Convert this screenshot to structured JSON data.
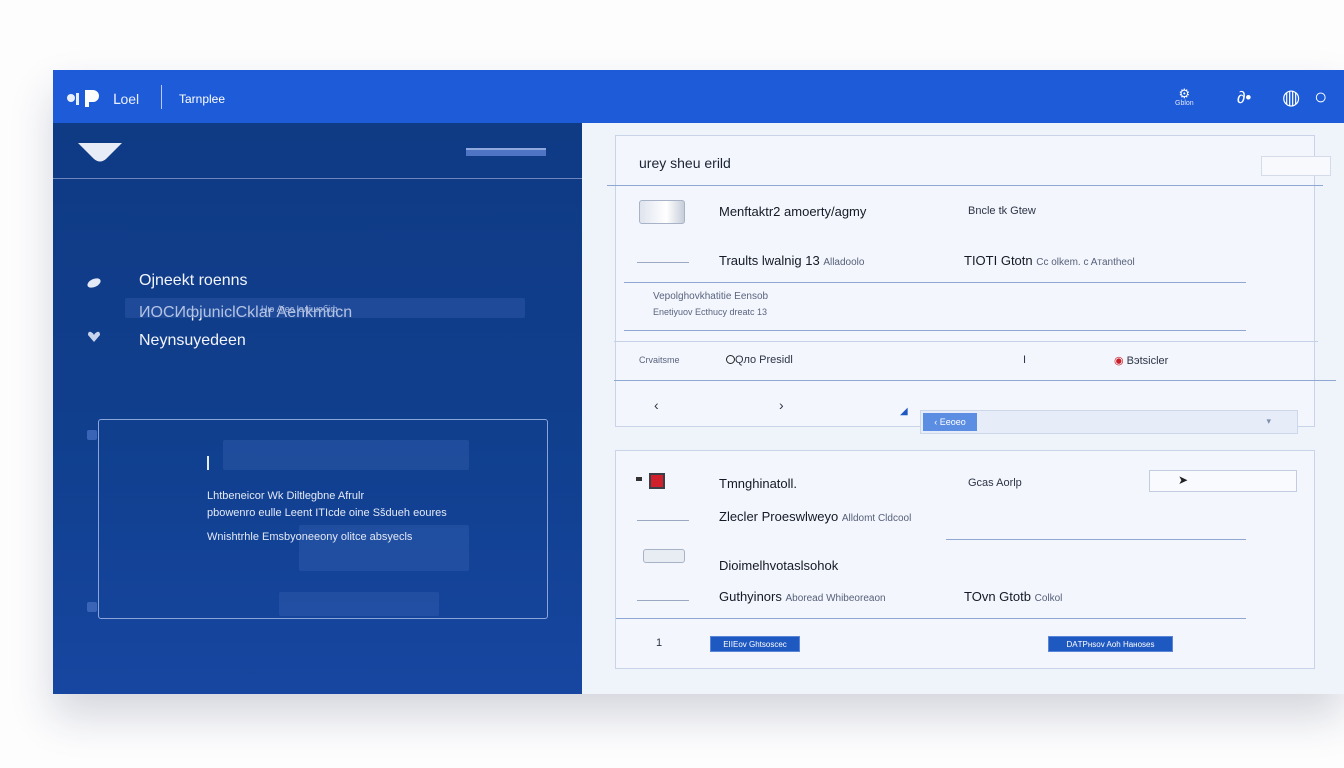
{
  "topbar": {
    "app_title": "Լoel",
    "tab_label": "Tarnplee",
    "icons": [
      {
        "name": "settings-icon",
        "glyph": "⚙",
        "caption": "Gblon"
      },
      {
        "name": "run-icon",
        "glyph": "∂•",
        "caption": ""
      },
      {
        "name": "refresh-icon",
        "glyph": "◍",
        "caption": ""
      },
      {
        "name": "profile-circle-icon",
        "glyph": "○",
        "caption": ""
      }
    ]
  },
  "sidebar": {
    "items": [
      {
        "label": "Ojneekt roenns",
        "icon": "leaf-icon"
      },
      {
        "label": "ИОСИфjuniclCklar Aenkmucn",
        "icon": ""
      },
      {
        "label": "Neynsuyedeen",
        "icon": "heart-icon"
      }
    ],
    "note": "Hю Aіес lолішобіф",
    "box": {
      "cursor": "I",
      "lines": [
        "Lhtbeneicor Wk Diltlegbne Afrulr",
        "pbowenro eulle Leent ITIcde oine Sšdueh eoures",
        "Wnishtrhle Emsbyoneeony olitce absyecls"
      ]
    }
  },
  "panel": {
    "card1": {
      "title": "urey sheu erild",
      "row1": {
        "name": "Menftaktr2 amoerty/agmy",
        "value": "Bncle tk Gtew"
      },
      "row2": {
        "name": "Traults lwalnig 13",
        "name_sub": "Alladoolo",
        "value": "TIOTI Gtotn",
        "value_sub": "Cc olkem. c Aтantheol"
      },
      "desc1": "Vepolghovkhatitie Eensob",
      "desc2": "Enetiyuov Ecthucy dreatc 13",
      "row3": {
        "label": "Crvaitsme",
        "radio": "Qлo Presidl",
        "mid": "I",
        "right": "Bэtsicler"
      },
      "nav_left": "‹",
      "nav_right": "›",
      "dropdown_chip": "‹ Eeoeo",
      "dropdown_caret": "▾"
    },
    "card2": {
      "row1": {
        "name": "Tmnghinatoll.",
        "value": "Gcas Aorlp"
      },
      "row2": {
        "name": "Zlecler Proeswlweyo",
        "name_sub": "Alldomt Cldcool"
      },
      "row3": {
        "name": "Dioimelhvotaslsohok"
      },
      "row4": {
        "name": "Guthyinors",
        "name_sub": "Aboread Whibeoreaon",
        "value": "TOvn Gtotb",
        "value_sub": "Colkol"
      },
      "page": "1",
      "btn1": "EIIEov Ghtsoscec",
      "btn2": "DAТPнsov Aoh Haнoses"
    }
  }
}
